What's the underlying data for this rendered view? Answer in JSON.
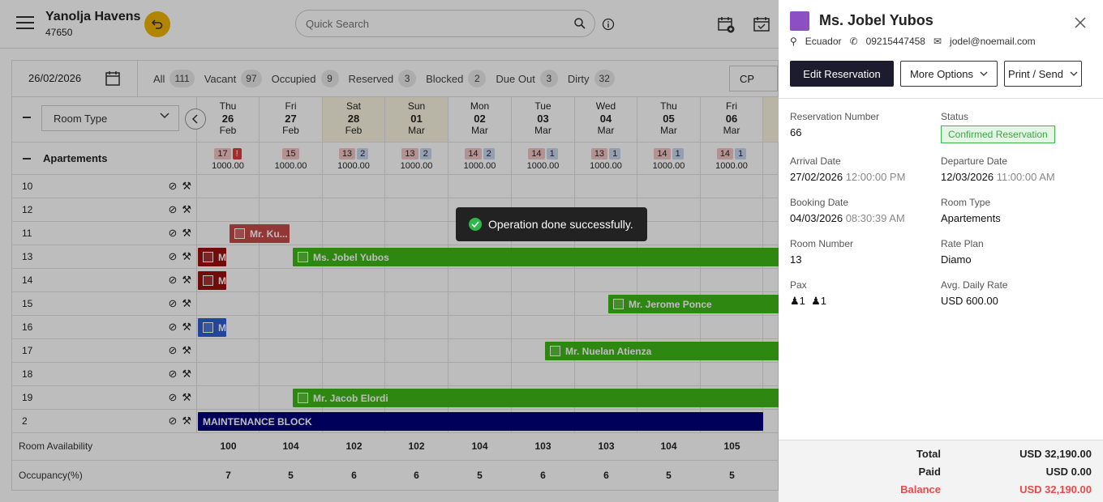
{
  "hotel": {
    "name": "Yanolja Havens",
    "id": "47650"
  },
  "search": {
    "placeholder": "Quick Search"
  },
  "filterbar": {
    "date": "26/02/2026",
    "filters": [
      {
        "label": "All",
        "count": "111"
      },
      {
        "label": "Vacant",
        "count": "97"
      },
      {
        "label": "Occupied",
        "count": "9"
      },
      {
        "label": "Reserved",
        "count": "3"
      },
      {
        "label": "Blocked",
        "count": "2"
      },
      {
        "label": "Due Out",
        "count": "3"
      },
      {
        "label": "Dirty",
        "count": "32"
      }
    ],
    "cp_value": "CP"
  },
  "grid": {
    "room_type_select": "Room Type",
    "days": [
      {
        "dow": "Thu",
        "num": "26",
        "mon": "Feb",
        "b1": "17",
        "b2": "!",
        "rate": "1000.00"
      },
      {
        "dow": "Fri",
        "num": "27",
        "mon": "Feb",
        "b1": "15",
        "b2": "",
        "rate": "1000.00"
      },
      {
        "dow": "Sat",
        "num": "28",
        "mon": "Feb",
        "b1": "13",
        "b2": "2",
        "rate": "1000.00"
      },
      {
        "dow": "Sun",
        "num": "01",
        "mon": "Mar",
        "b1": "13",
        "b2": "2",
        "rate": "1000.00"
      },
      {
        "dow": "Mon",
        "num": "02",
        "mon": "Mar",
        "b1": "14",
        "b2": "2",
        "rate": "1000.00"
      },
      {
        "dow": "Tue",
        "num": "03",
        "mon": "Mar",
        "b1": "14",
        "b2": "1",
        "rate": "1000.00"
      },
      {
        "dow": "Wed",
        "num": "04",
        "mon": "Mar",
        "b1": "13",
        "b2": "1",
        "rate": "1000.00"
      },
      {
        "dow": "Thu",
        "num": "05",
        "mon": "Mar",
        "b1": "14",
        "b2": "1",
        "rate": "1000.00"
      },
      {
        "dow": "Fri",
        "num": "06",
        "mon": "Mar",
        "b1": "14",
        "b2": "1",
        "rate": "1000.00"
      }
    ],
    "group": "Apartements",
    "rooms": [
      "10",
      "12",
      "11",
      "13",
      "14",
      "15",
      "16",
      "17",
      "18",
      "19",
      "2"
    ],
    "bookings": {
      "r11": "Mr. Ku...",
      "r13a": "M",
      "r13b": "Ms. Jobel Yubos",
      "r14": "M",
      "r15": "Mr. Jerome Ponce",
      "r16": "M",
      "r17": "Mr. Nuelan Atienza",
      "r19": "Mr. Jacob Elordi",
      "r2": "MAINTENANCE BLOCK"
    },
    "availability_label": "Room Availability",
    "availability": [
      "100",
      "104",
      "102",
      "102",
      "104",
      "103",
      "103",
      "104",
      "105"
    ],
    "occupancy_label": "Occupancy(%)",
    "occupancy": [
      "7",
      "5",
      "6",
      "6",
      "5",
      "6",
      "6",
      "5",
      "5"
    ]
  },
  "toast": {
    "message": "Operation done successfully."
  },
  "panel": {
    "guest_name": "Ms. Jobel Yubos",
    "country": "Ecuador",
    "phone": "09215447458",
    "email": "jodel@noemail.com",
    "edit_label": "Edit Reservation",
    "more_label": "More Options",
    "print_label": "Print / Send",
    "reservation_number_label": "Reservation Number",
    "reservation_number": "66",
    "status_label": "Status",
    "status": "Confirmed Reservation",
    "arrival_label": "Arrival Date",
    "arrival_date": "27/02/2026",
    "arrival_time": "12:00:00 PM",
    "departure_label": "Departure Date",
    "departure_date": "12/03/2026",
    "departure_time": "11:00:00 AM",
    "booking_label": "Booking Date",
    "booking_date": "04/03/2026",
    "booking_time": "08:30:39 AM",
    "room_type_label": "Room Type",
    "room_type": "Apartements",
    "room_number_label": "Room Number",
    "room_number": "13",
    "rate_plan_label": "Rate Plan",
    "rate_plan": "Diamo",
    "pax_label": "Pax",
    "pax_adults": "1",
    "pax_children": "1",
    "adr_label": "Avg. Daily Rate",
    "adr": "USD 600.00",
    "total_label": "Total",
    "total": "USD 32,190.00",
    "paid_label": "Paid",
    "paid": "USD 0.00",
    "balance_label": "Balance",
    "balance": "USD 32,190.00"
  }
}
